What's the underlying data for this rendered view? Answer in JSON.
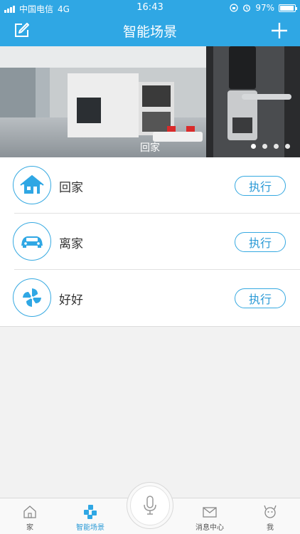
{
  "status": {
    "carrier": "中国电信",
    "network": "4G",
    "time": "16:43",
    "battery": "97%",
    "battery_level": 0.97
  },
  "header": {
    "title": "智能场景",
    "edit_icon": "edit-icon",
    "add_icon": "plus-icon"
  },
  "banner": {
    "caption": "回家",
    "dots": 4,
    "active_dot": 0
  },
  "scenes": [
    {
      "name": "回家",
      "icon": "home-icon",
      "action": "执行"
    },
    {
      "name": "离家",
      "icon": "car-icon",
      "action": "执行"
    },
    {
      "name": "好好",
      "icon": "pinwheel-icon",
      "action": "执行"
    }
  ],
  "tabbar": {
    "tabs": [
      {
        "label": "家",
        "icon": "house-icon",
        "active": false
      },
      {
        "label": "智能场景",
        "icon": "scene-icon",
        "active": true
      },
      {
        "label": "消息中心",
        "icon": "mail-icon",
        "active": false
      },
      {
        "label": "我",
        "icon": "profile-icon",
        "active": false
      }
    ],
    "center_icon": "microphone-icon"
  },
  "colors": {
    "primary": "#2fa7e4",
    "accent": "#36a9e1",
    "background": "#f2f2f2"
  }
}
